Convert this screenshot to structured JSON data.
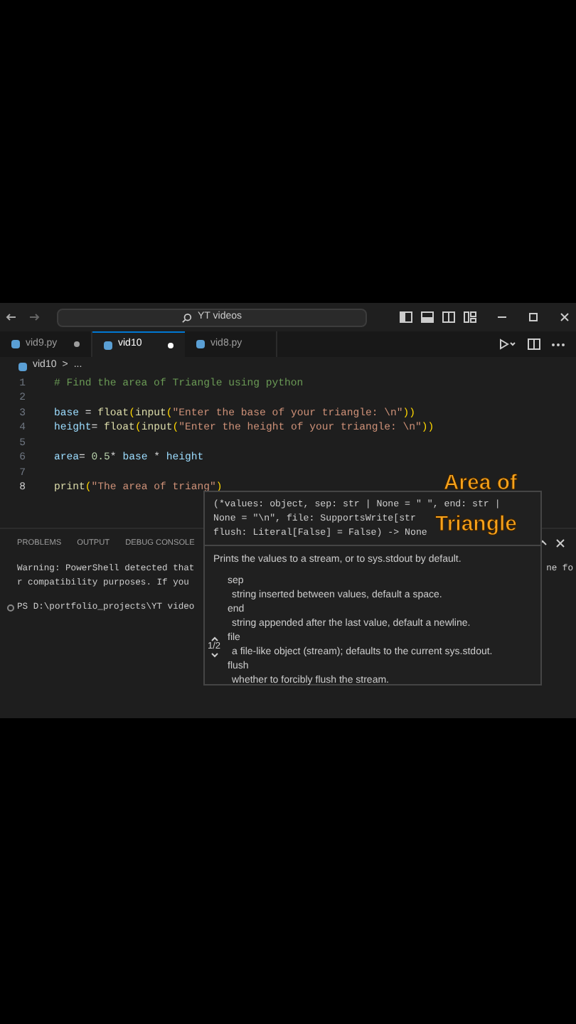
{
  "title_bar": {
    "search": "YT videos"
  },
  "tabs": [
    {
      "label": "vid9.py",
      "selected": false,
      "dirty": true
    },
    {
      "label": "vid10",
      "selected": true,
      "dirty": true
    },
    {
      "label": "vid8.py",
      "selected": false,
      "dirty": false
    }
  ],
  "breadcrumb": {
    "file": "vid10",
    "separator": ">",
    "rest": "..."
  },
  "code_lines": [
    {
      "number": "1",
      "active": false,
      "tokens": [
        {
          "text": "# Find the area of Triangle using python",
          "kind": "comment"
        }
      ]
    },
    {
      "number": "2",
      "active": false
    },
    {
      "number": "3",
      "active": false,
      "tokens": [
        {
          "text": "base",
          "kind": "var"
        },
        {
          "text": " = ",
          "kind": "op"
        },
        {
          "text": "float",
          "kind": "func"
        },
        {
          "text": "(",
          "kind": "paren"
        },
        {
          "text": "input",
          "kind": "func"
        },
        {
          "text": "(",
          "kind": "paren"
        },
        {
          "text": "\"Enter the base of your triangle: \\n\"",
          "kind": "str"
        },
        {
          "text": "))",
          "kind": "paren"
        }
      ]
    },
    {
      "number": "4",
      "active": false,
      "tokens": [
        {
          "text": "height",
          "kind": "var"
        },
        {
          "text": "= ",
          "kind": "op"
        },
        {
          "text": "float",
          "kind": "func"
        },
        {
          "text": "(",
          "kind": "paren"
        },
        {
          "text": "input",
          "kind": "func"
        },
        {
          "text": "(",
          "kind": "paren"
        },
        {
          "text": "\"Enter the height of your triangle: \\n\"",
          "kind": "str"
        },
        {
          "text": "))",
          "kind": "paren"
        }
      ]
    },
    {
      "number": "5",
      "active": false
    },
    {
      "number": "6",
      "active": false,
      "tokens": [
        {
          "text": "area",
          "kind": "var"
        },
        {
          "text": "= ",
          "kind": "op"
        },
        {
          "text": "0.5",
          "kind": "num"
        },
        {
          "text": "* ",
          "kind": "op"
        },
        {
          "text": "base",
          "kind": "var"
        },
        {
          "text": " * ",
          "kind": "op"
        },
        {
          "text": "height",
          "kind": "var"
        }
      ]
    },
    {
      "number": "7",
      "active": false
    },
    {
      "number": "8",
      "active": true,
      "tokens": [
        {
          "text": "print",
          "kind": "func"
        },
        {
          "text": "(",
          "kind": "paren"
        },
        {
          "text": "\"The area of triang\"",
          "kind": "str"
        },
        {
          "text": ")",
          "kind": "paren"
        }
      ]
    }
  ],
  "panel_tabs": [
    {
      "label": "PROBLEMS"
    },
    {
      "label": "OUTPUT"
    },
    {
      "label": "DEBUG CONSOLE"
    }
  ],
  "terminal": {
    "lines": [
      "Warning: PowerShell detected that",
      "r compatibility purposes. If you ",
      "PS D:\\portfolio_projects\\YT video"
    ],
    "right_fragment": "ne fo"
  },
  "hover": {
    "signature": [
      "(*values: object, sep: str | None = \" \", end: str |",
      "None = \"\\n\", file: SupportsWrite[str",
      "flush: Literal[False] = False) -> None"
    ],
    "description": "Prints the values to a stream, or to sys.stdout by default.",
    "params": [
      {
        "name": "sep",
        "doc": "string inserted between values, default a space."
      },
      {
        "name": "end",
        "doc": "string appended after the last value, default a newline."
      },
      {
        "name": "file",
        "doc": "a file-like object (stream); defaults to the current sys.stdout."
      },
      {
        "name": "flush",
        "doc": "whether to forcibly flush the stream."
      }
    ],
    "page": "1/2"
  },
  "caption": [
    "Area of",
    "Triangle"
  ]
}
